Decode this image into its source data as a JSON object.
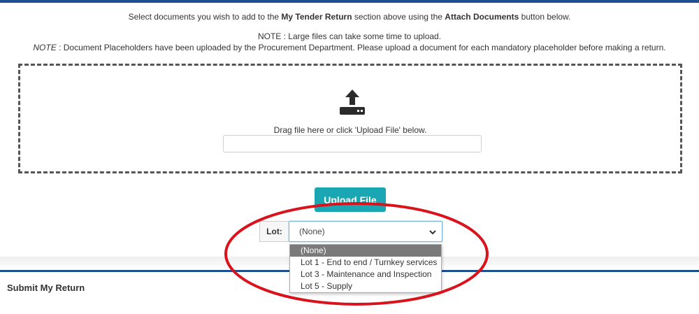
{
  "instructions": {
    "line1_pre": "Select documents you wish to add to the ",
    "line1_bold1": "My Tender Return",
    "line1_mid": " section above using the ",
    "line1_bold2": "Attach Documents",
    "line1_post": " button below.",
    "line2": "NOTE : Large files can take some time to upload.",
    "line3_italic": "NOTE",
    "line3_rest": " : Document Placeholders have been uploaded by the Procurement Department. Please upload a document for each mandatory placeholder before making a return."
  },
  "dropzone": {
    "icon": "upload-icon",
    "drag_text": "Drag file here or click 'Upload File' below.",
    "file_value": ""
  },
  "upload_button": {
    "label": "Upload File"
  },
  "lot": {
    "label": "Lot:",
    "selected": "(None)",
    "options": [
      "(None)",
      "Lot 1 - End to end / Turnkey services",
      "Lot 3 - Maintenance and Inspection",
      "Lot 5 - Supply"
    ]
  },
  "submit_section": {
    "title": "Submit My Return"
  },
  "colors": {
    "rule_blue": "#1b4f8f",
    "button_teal": "#1aa7b3",
    "annotation_red": "#d9121c",
    "highlight_grey": "#7a7a7a"
  }
}
